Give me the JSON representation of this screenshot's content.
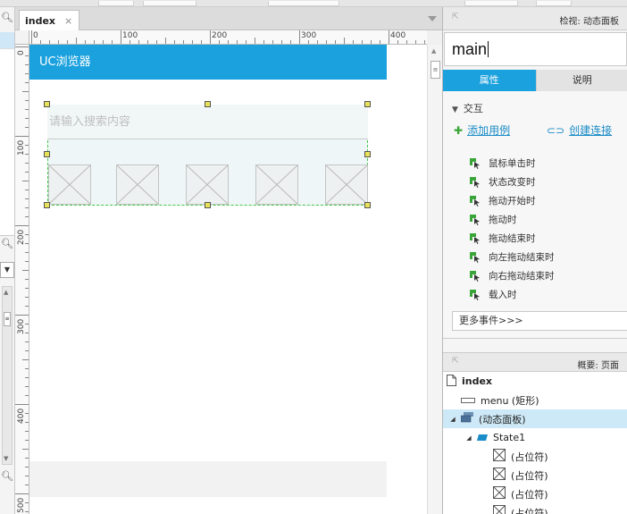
{
  "document_tab": {
    "label": "index",
    "close": "×"
  },
  "ruler": {
    "h_labels": [
      "0",
      "100",
      "200",
      "300",
      "400"
    ],
    "v_labels": [
      "0",
      "100",
      "200",
      "300",
      "400",
      "500"
    ]
  },
  "canvas": {
    "header_text": "UC浏览器",
    "search_placeholder": "请输入搜索内容",
    "placeholder_count": 5
  },
  "inspector": {
    "title": "检视: 动态面板",
    "name_value": "main",
    "tabs": [
      {
        "label": "属性",
        "active": true
      },
      {
        "label": "说明",
        "active": false
      }
    ],
    "section_title": "交互",
    "add_case": "添加用例",
    "create_link": "创建连接",
    "events": [
      "鼠标单击时",
      "状态改变时",
      "拖动开始时",
      "拖动时",
      "拖动结束时",
      "向左拖动结束时",
      "向右拖动结束时",
      "载入时"
    ],
    "more_events": "更多事件>>>"
  },
  "outline": {
    "title": "概要: 页面",
    "items": [
      {
        "label": "index",
        "icon": "page-icon"
      },
      {
        "label": "menu (矩形)",
        "icon": "rectangle-icon"
      },
      {
        "label": "(动态面板)",
        "icon": "dynamic-panel-icon"
      },
      {
        "label": "State1",
        "icon": "state-icon"
      },
      {
        "label": "(占位符)",
        "icon": "placeholder-icon"
      },
      {
        "label": "(占位符)",
        "icon": "placeholder-icon"
      },
      {
        "label": "(占位符)",
        "icon": "placeholder-icon"
      },
      {
        "label": "(占位符)",
        "icon": "placeholder-icon"
      }
    ]
  },
  "colors": {
    "accent": "#1aa1de",
    "selection_dash": "#45c645",
    "handle": "#e8e25a",
    "link": "#1a8cc7",
    "event_icon": "#3aa63a"
  }
}
